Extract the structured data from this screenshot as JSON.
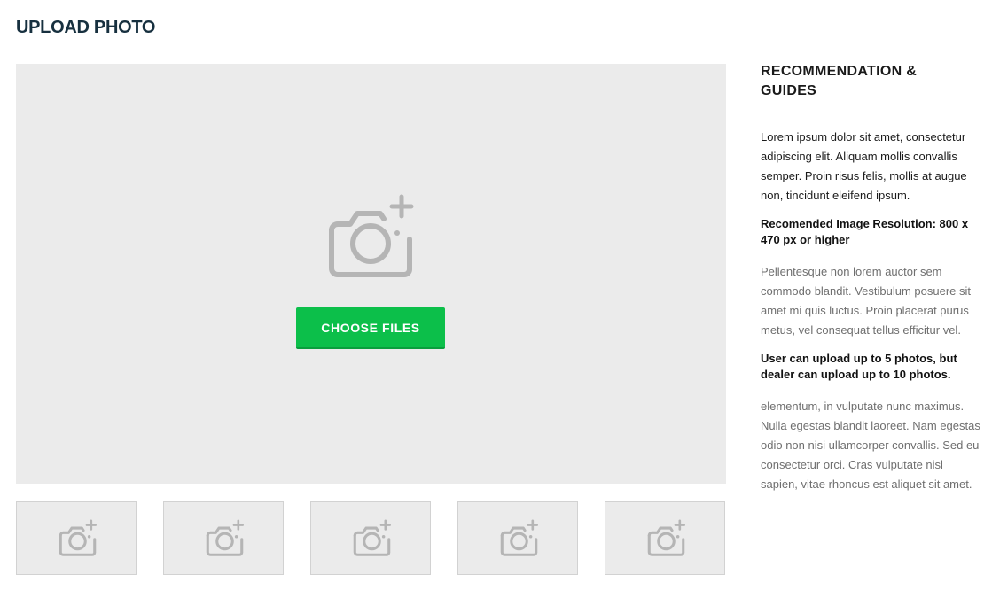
{
  "page": {
    "title": "UPLOAD PHOTO"
  },
  "upload": {
    "main_icon": "camera-plus-icon",
    "choose_button_label": "CHOOSE FILES",
    "button_color": "#0cbf4a",
    "dropzone_color": "#ebebeb",
    "thumbnails": [
      {
        "icon": "camera-plus-icon"
      },
      {
        "icon": "camera-plus-icon"
      },
      {
        "icon": "camera-plus-icon"
      },
      {
        "icon": "camera-plus-icon"
      },
      {
        "icon": "camera-plus-icon"
      }
    ]
  },
  "guides": {
    "title": "RECOMMENDATION & GUIDES",
    "intro": "Lorem ipsum dolor sit amet, consectetur adipiscing elit. Aliquam mollis convallis semper. Proin risus felis, mollis at augue non, tincidunt eleifend ipsum.",
    "resolution_note": "Recomended Image Resolution: 800 x 470 px or higher",
    "paragraph_two": "Pellentesque non lorem auctor sem commodo blandit. Vestibulum posuere sit amet mi quis luctus. Proin placerat purus metus, vel consequat tellus efficitur vel.",
    "upload_limit_note": "User can upload up to 5 photos, but dealer can upload up to 10 photos.",
    "paragraph_three": "elementum, in vulputate nunc maximus. Nulla egestas blandit laoreet. Nam egestas odio non nisi ullamcorper convallis. Sed eu consectetur orci. Cras vulputate nisl sapien, vitae rhoncus est aliquet sit amet."
  }
}
